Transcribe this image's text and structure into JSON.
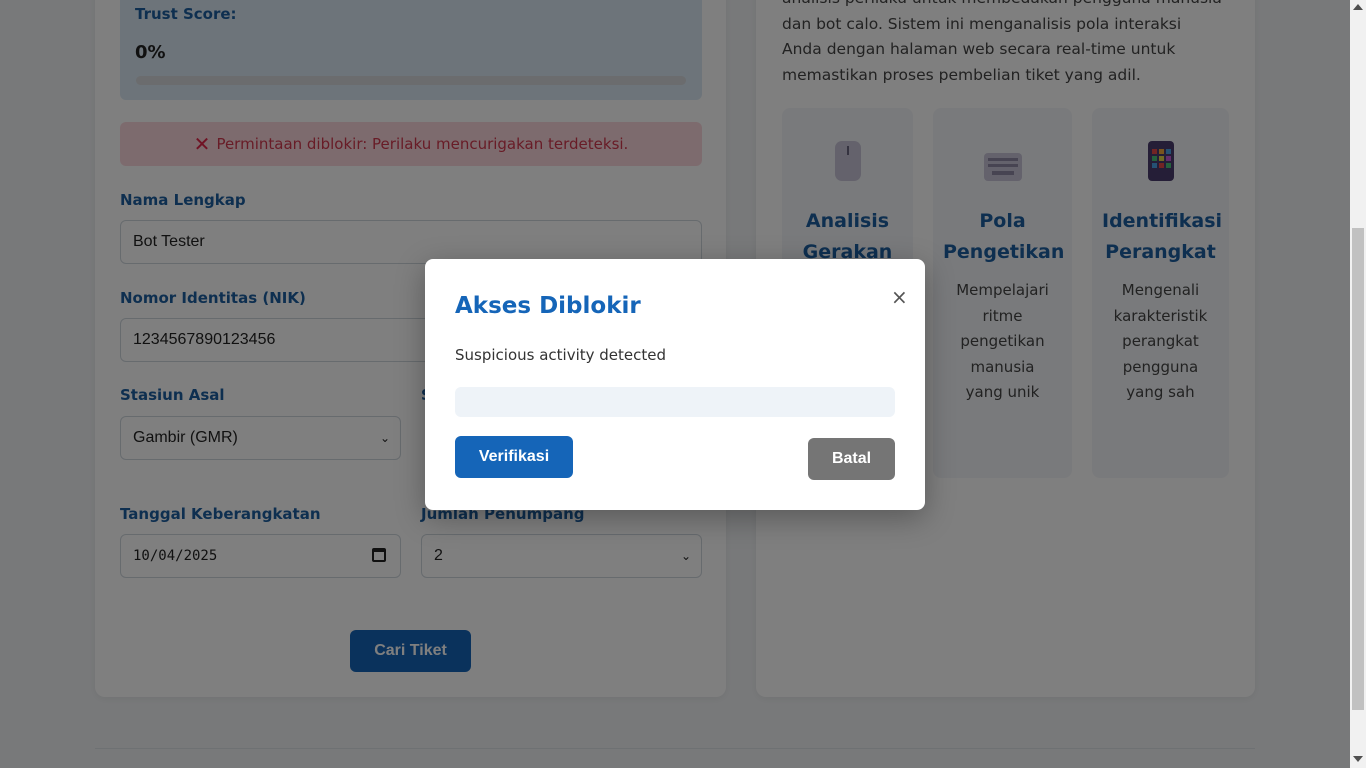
{
  "trust": {
    "label": "Trust Score:",
    "value": "0%",
    "progress_fraction": 0
  },
  "alert": {
    "icon": "x-mark-icon",
    "message": "Permintaan diblokir: Perilaku mencurigakan terdeteksi."
  },
  "form": {
    "name_label": "Nama Lengkap",
    "name_value": "Bot Tester",
    "nik_label": "Nomor Identitas (NIK)",
    "nik_value": "1234567890123456",
    "origin_label": "Stasiun Asal",
    "origin_value": "Gambir (GMR)",
    "dest_label_partial": "S",
    "date_label": "Tanggal Keberangkatan",
    "date_value": "10/04/2025",
    "passengers_label": "Jumlah Penumpang",
    "passengers_value": "2",
    "submit_label": "Cari Tiket"
  },
  "info": {
    "paragraph": "analisis perilaku untuk membedakan pengguna manusia dan bot calo. Sistem ini menganalisis pola interaksi Anda dengan halaman web secara real-time untuk memastikan proses pembelian tiket yang adil.",
    "features": [
      {
        "icon": "mouse-icon",
        "title": "Analisis Gerakan",
        "desc": ""
      },
      {
        "icon": "keyboard-icon",
        "title": "Pola Pengetikan",
        "desc": "Mempelajari ritme pengetikan manusia yang unik"
      },
      {
        "icon": "device-icon",
        "title": "Identifikasi Perangkat",
        "desc": "Mengenali karakteristik perangkat pengguna yang sah"
      }
    ]
  },
  "modal": {
    "title": "Akses Diblokir",
    "close": "×",
    "message": "Suspicious activity detected",
    "verify_label": "Verifikasi",
    "cancel_label": "Batal"
  },
  "colors": {
    "primary": "#1565b8",
    "alert_bg": "#fbd7dc",
    "alert_text": "#d0394e",
    "cancel": "#757575"
  }
}
